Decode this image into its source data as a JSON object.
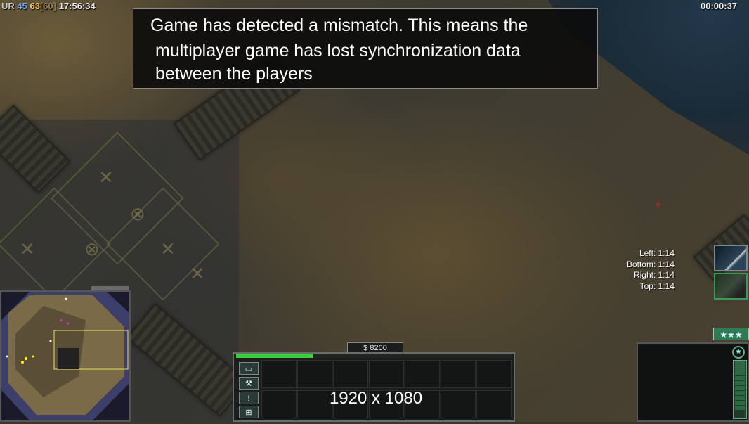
{
  "hud": {
    "ur_label": "UR",
    "stat_a": "45",
    "stat_b": "63",
    "stat_c": "[60]",
    "time_of_day": "17:56:34",
    "game_timer": "00:00:37"
  },
  "message": {
    "line1": "Game has detected a mismatch. This means the",
    "line2": "multiplayer game has lost synchronization data",
    "line3": "between the players"
  },
  "bounds": {
    "left": "Left: 1:14",
    "bottom": "Bottom: 1:14",
    "right": "Right: 1:14",
    "top": "Top: 1:14"
  },
  "command_bar": {
    "money": "$ 8200",
    "build_progress": 0.28,
    "resolution_label": "1920 x 1080",
    "side_buttons": [
      "▭",
      "⚒",
      "!",
      "⊞"
    ]
  },
  "sidebar": {
    "rank_stars": "★★★"
  },
  "colors": {
    "progress": "#3bd13b",
    "ur_blue": "#6fa8ff",
    "ur_yellow": "#ffd24a"
  }
}
